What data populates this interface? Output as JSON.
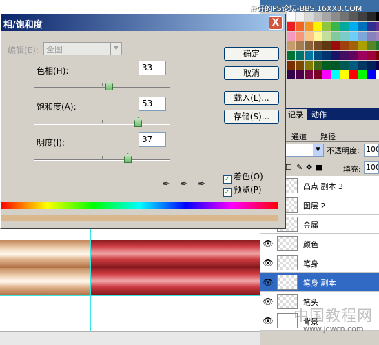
{
  "watermark_top": "最好的PS论坛-BBS.16XX8.COM",
  "watermark_bottom": "www.jcwcn.com",
  "watermark_big": "中国教程网",
  "dialog": {
    "title": "相/饱和度",
    "close_label": "X",
    "edit_label": "编辑(E):",
    "edit_value": "全图",
    "hue_label": "色相(H):",
    "hue_value": "33",
    "hue_level": 0.55,
    "saturation_label": "饱和度(A):",
    "saturation_value": "53",
    "saturation_level": 0.765,
    "lightness_label": "明度(I):",
    "lightness_value": "37",
    "lightness_level": 0.685,
    "buttons": {
      "ok": "确定",
      "cancel": "取消",
      "load": "载入(L)...",
      "save": "存储(S)..."
    },
    "colorize_label": "着色(O)",
    "colorize_checked": true,
    "preview_label": "预览(P)",
    "preview_checked": true,
    "check_mark": "✓",
    "droppers": [
      "eyedropper-icon",
      "eyedropper-plus-icon",
      "eyedropper-minus-icon"
    ]
  },
  "history_tabs": [
    "记录",
    "动作"
  ],
  "layers_tabs": [
    "通道",
    "路径"
  ],
  "opacity_label": "不透明度:",
  "opacity_value": "100",
  "fill_label": "填充:",
  "fill_value": "100",
  "layers": [
    {
      "name": "凸点 副本 3",
      "visible": false,
      "active": false
    },
    {
      "name": "图层 2",
      "visible": false,
      "active": false
    },
    {
      "name": "金属",
      "visible": false,
      "active": false
    },
    {
      "name": "颜色",
      "visible": true,
      "active": false
    },
    {
      "name": "笔身",
      "visible": true,
      "active": false
    },
    {
      "name": "笔身 副本",
      "visible": true,
      "active": true
    },
    {
      "name": "笔头",
      "visible": true,
      "active": false
    },
    {
      "name": "背景",
      "visible": true,
      "active": false
    }
  ],
  "eye_glyph": "👁",
  "colors": {
    "title_bar": "#0a246a",
    "selected_layer": "#316ac5",
    "swatches": [
      "#ffffff",
      "#f2f2f2",
      "#d9d9d9",
      "#bfbfbf",
      "#a6a6a6",
      "#8c8c8c",
      "#737373",
      "#595959",
      "#404040",
      "#262626",
      "#000000",
      "#ed1c24",
      "#f26522",
      "#f7941d",
      "#fff200",
      "#8dc63f",
      "#39b54a",
      "#00a99d",
      "#00aeef",
      "#0072bc",
      "#2e3192",
      "#662d91",
      "#f49ac1",
      "#f7977a",
      "#fdc689",
      "#fff799",
      "#c4df9b",
      "#82ca9c",
      "#7accc8",
      "#6dcff6",
      "#7da7d9",
      "#8781bd",
      "#a186be",
      "#c69c6d",
      "#a67c52",
      "#8c6239",
      "#754c24",
      "#603913",
      "#9e0b0f",
      "#a0410d",
      "#a36209",
      "#aba000",
      "#598527",
      "#1a7b30",
      "#007236",
      "#00746b",
      "#0076a3",
      "#004b80",
      "#003471",
      "#1b1464",
      "#440e62",
      "#630460",
      "#9e005d",
      "#9e0039",
      "#790000",
      "#7b2e00",
      "#7d4900",
      "#827b00",
      "#406618",
      "#005e20",
      "#005826",
      "#005952",
      "#005b7f",
      "#003663",
      "#002157",
      "#0d004c",
      "#32004b",
      "#4b0049",
      "#7b0046",
      "#7a0026",
      "#ff00ff",
      "#00ffff",
      "#ffff00",
      "#ff0000",
      "#00ff00",
      "#0000ff",
      "#ffffff"
    ]
  }
}
